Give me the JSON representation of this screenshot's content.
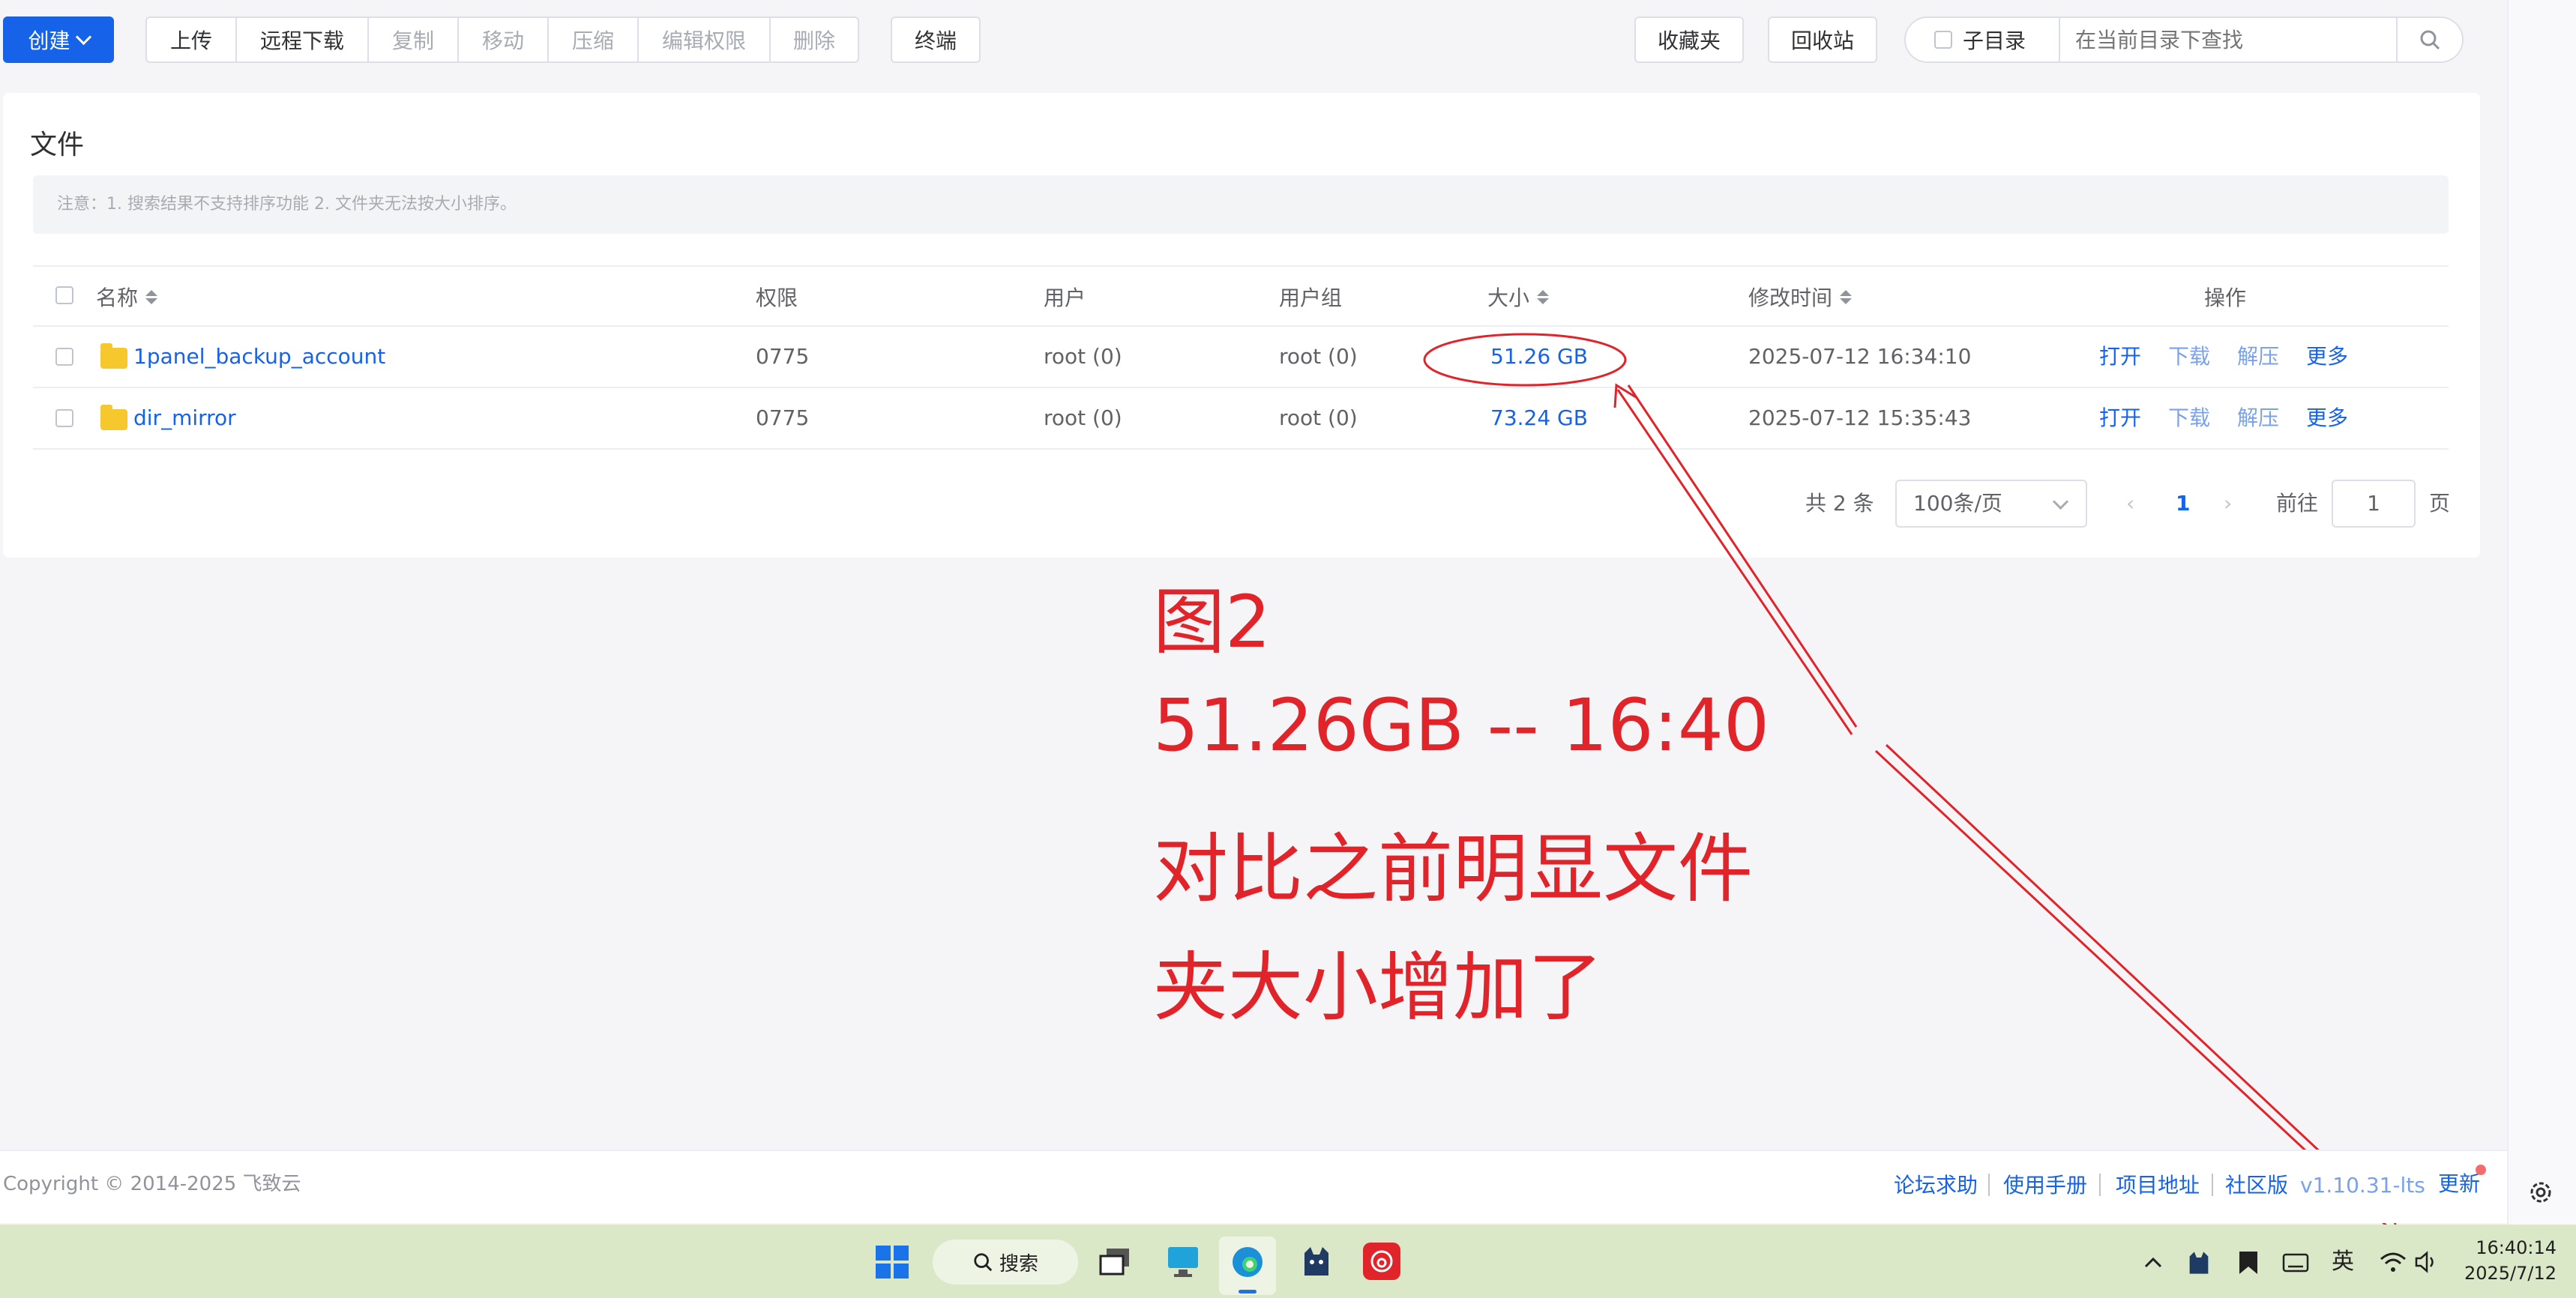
{
  "toolbar": {
    "create_label": "创建",
    "upload_label": "上传",
    "remote_download_label": "远程下载",
    "copy_label": "复制",
    "move_label": "移动",
    "compress_label": "压缩",
    "edit_permission_label": "编辑权限",
    "delete_label": "删除",
    "terminal_label": "终端",
    "favorites_label": "收藏夹",
    "recycle_bin_label": "回收站",
    "subdir_label": "子目录",
    "search_placeholder": "在当前目录下查找"
  },
  "card": {
    "title": "文件",
    "notice": "注意：1. 搜索结果不支持排序功能 2. 文件夹无法按大小排序。"
  },
  "table": {
    "headers": {
      "name": "名称",
      "permission": "权限",
      "user": "用户",
      "group": "用户组",
      "size": "大小",
      "modified": "修改时间",
      "actions": "操作"
    },
    "rows": [
      {
        "name": "1panel_backup_account",
        "permission": "0775",
        "user": "root (0)",
        "group": "root (0)",
        "size": "51.26 GB",
        "modified": "2025-07-12 16:34:10"
      },
      {
        "name": "dir_mirror",
        "permission": "0775",
        "user": "root (0)",
        "group": "root (0)",
        "size": "73.24 GB",
        "modified": "2025-07-12 15:35:43"
      }
    ],
    "actions": {
      "open": "打开",
      "download": "下载",
      "extract": "解压",
      "more": "更多"
    }
  },
  "pagination": {
    "total": "共 2 条",
    "page_size": "100条/页",
    "current_page": "1",
    "goto_label": "前往",
    "goto_value": "1",
    "page_suffix": "页"
  },
  "footer": {
    "copyright": "Copyright © 2014-2025 飞致云",
    "forum": "论坛求助",
    "manual": "使用手册",
    "project": "项目地址",
    "edition": "社区版",
    "version": "v1.10.31-lts",
    "update": "更新"
  },
  "annotation": {
    "line1": "图2",
    "line2": "51.26GB -- 16:40",
    "line3": "对比之前明显文件",
    "line4": "夹大小增加了"
  },
  "taskbar": {
    "search_label": "搜索",
    "ime_label": "英",
    "time": "16:40:14",
    "date": "2025/7/12"
  },
  "colors": {
    "primary": "#1662e8",
    "annotation_red": "#e0242a",
    "taskbar_bg": "#dbe8c8"
  }
}
